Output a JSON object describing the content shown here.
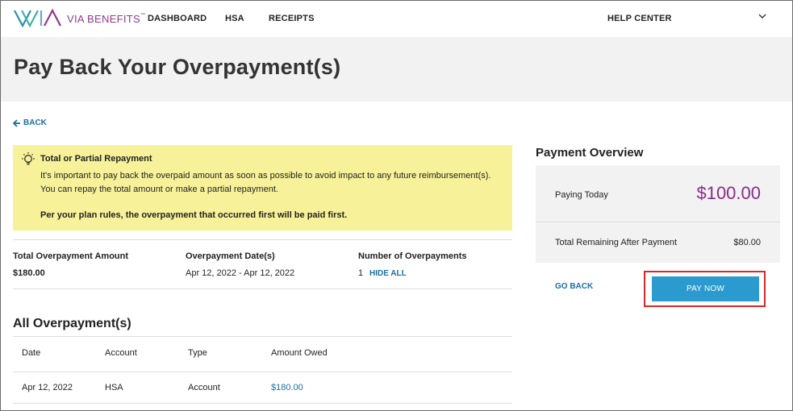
{
  "header": {
    "logo_text": "VIA BENEFITS",
    "logo_tm": "™",
    "nav": [
      "DASHBOARD",
      "HSA",
      "RECEIPTS"
    ],
    "help": "HELP CENTER"
  },
  "page_title": "Pay Back Your Overpayment(s)",
  "back_label": "BACK",
  "callout": {
    "title": "Total or Partial Repayment",
    "body": "It's important to pay back the overpaid amount as soon as possible to avoid impact to any future reimbursement(s). You can repay the total amount or make a partial repayment.",
    "note": "Per your plan rules, the overpayment that occurred first will be paid first."
  },
  "summary": {
    "total_label": "Total Overpayment Amount",
    "total_value": "$180.00",
    "dates_label": "Overpayment Date(s)",
    "dates_value": "Apr 12, 2022 - Apr 12, 2022",
    "count_label": "Number of Overpayments",
    "count_value": "1",
    "hide_all": "HIDE ALL"
  },
  "table": {
    "title": "All Overpayment(s)",
    "headers": [
      "Date",
      "Account",
      "Type",
      "Amount Owed"
    ],
    "rows": [
      [
        "Apr 12, 2022",
        "HSA",
        "Account",
        "$180.00"
      ]
    ]
  },
  "overview": {
    "title": "Payment Overview",
    "paying_label": "Paying Today",
    "paying_value": "$100.00",
    "remaining_label": "Total Remaining After Payment",
    "remaining_value": "$80.00",
    "go_back": "GO BACK",
    "pay_now": "PAY NOW"
  },
  "colors": {
    "accent": "#8c2a8a",
    "link": "#1d6ea0",
    "button": "#2b9bcf",
    "callout_bg": "#f7f29a",
    "highlight": "#d9262b"
  }
}
